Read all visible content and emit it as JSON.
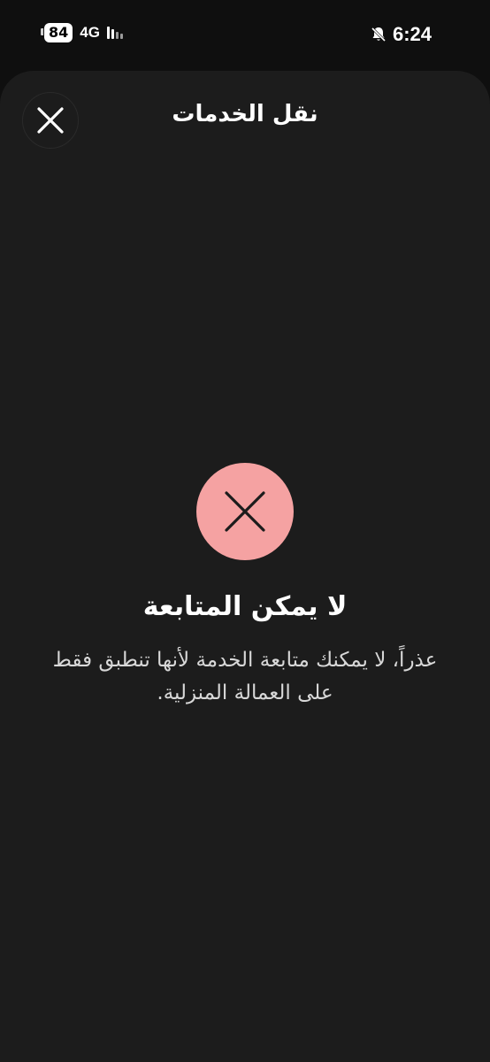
{
  "status_bar": {
    "battery_level": "84",
    "network_type": "4G",
    "time": "6:24",
    "icons": [
      "battery-icon",
      "signal-icon",
      "bell-muted-icon"
    ]
  },
  "header": {
    "title": "نقل الخدمات",
    "close_icon": "close-icon"
  },
  "error": {
    "icon": "x-icon",
    "icon_background": "#f5a2a2",
    "title": "لا يمكن المتابعة",
    "message": "عذراً، لا يمكنك متابعة الخدمة لأنها تنطبق فقط على العمالة المنزلية."
  },
  "colors": {
    "background": "#1c1c1c",
    "status_background": "#0f0f0f",
    "text_primary": "#ffffff",
    "text_secondary": "#d8d8d8"
  }
}
